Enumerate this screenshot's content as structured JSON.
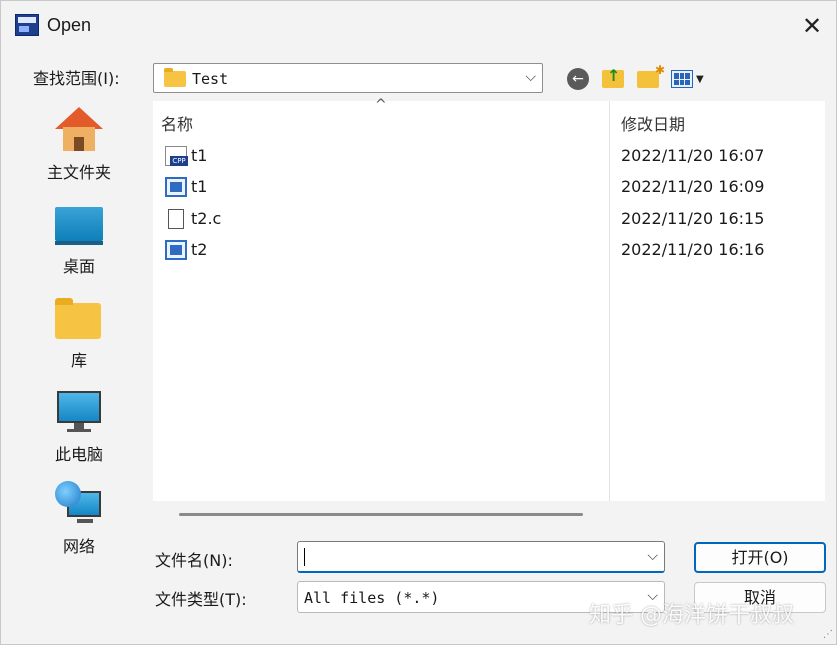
{
  "window": {
    "title": "Open",
    "close_glyph": "✕"
  },
  "lookin": {
    "label": "查找范围(I):",
    "value": "Test",
    "arrow": "⌵"
  },
  "toolbar": {
    "back_icon": "back-arrow-icon",
    "up_icon": "up-folder-icon",
    "new_folder_icon": "new-folder-icon",
    "view_icon": "view-menu-icon"
  },
  "places": [
    {
      "label": "主文件夹",
      "icon": "home-icon"
    },
    {
      "label": "桌面",
      "icon": "desktop-icon"
    },
    {
      "label": "库",
      "icon": "library-folder-icon"
    },
    {
      "label": "此电脑",
      "icon": "computer-icon"
    },
    {
      "label": "网络",
      "icon": "network-icon"
    }
  ],
  "filelist": {
    "columns": [
      "名称",
      "修改日期"
    ],
    "sort_indicator": "^",
    "rows": [
      {
        "name": "t1",
        "date": "2022/11/20 16:07",
        "icon": "cpp-file-icon"
      },
      {
        "name": "t1",
        "date": "2022/11/20 16:09",
        "icon": "exe-file-icon"
      },
      {
        "name": "t2.c",
        "date": "2022/11/20 16:15",
        "icon": "c-file-icon"
      },
      {
        "name": "t2",
        "date": "2022/11/20 16:16",
        "icon": "exe-file-icon"
      }
    ]
  },
  "form": {
    "filename_label": "文件名(N):",
    "filename_value": "",
    "filetype_label": "文件类型(T):",
    "filetype_value": "All files (*.*)",
    "dropdown_arrow": "⌵"
  },
  "buttons": {
    "open": "打开(O)",
    "cancel": "取消"
  },
  "watermark": "知乎 @海洋饼干叔叔",
  "colors": {
    "accent": "#0067c0",
    "folder": "#f6c343",
    "background": "#f3f3f3"
  }
}
